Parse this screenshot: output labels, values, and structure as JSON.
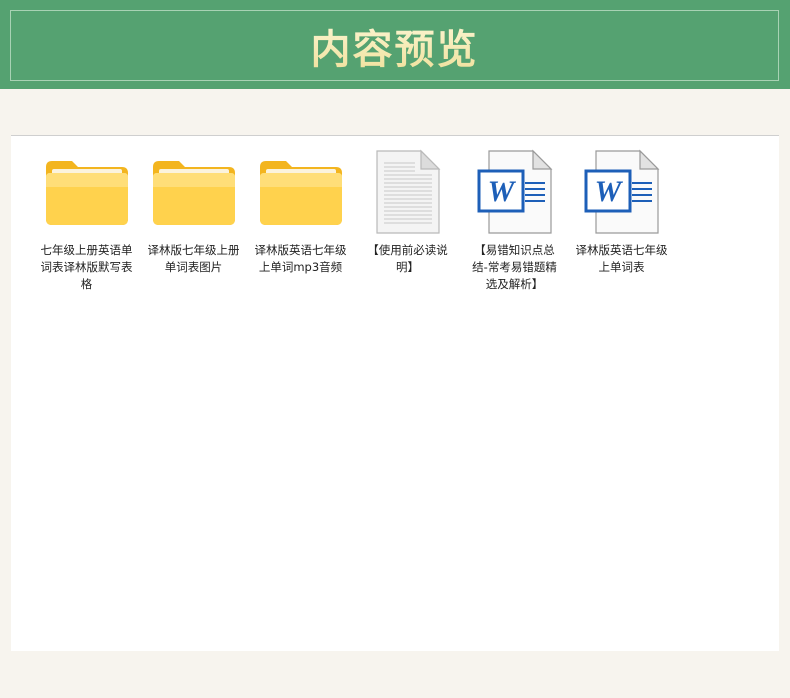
{
  "header": {
    "title": "内容预览"
  },
  "colors": {
    "banner": "#55a271",
    "title": "#f6eebb",
    "folder": "#ffd24d",
    "word_blue": "#1d5fb8"
  },
  "files": [
    {
      "type": "folder",
      "icon": "folder-icon",
      "label": "七年级上册英语单词表译林版默写表格"
    },
    {
      "type": "folder",
      "icon": "folder-icon",
      "label": "译林版七年级上册单词表图片"
    },
    {
      "type": "folder",
      "icon": "folder-icon",
      "label": "译林版英语七年级上单词mp3音频"
    },
    {
      "type": "text",
      "icon": "text-document-icon",
      "label": "【使用前必读说明】"
    },
    {
      "type": "word",
      "icon": "word-document-icon",
      "label": "【易错知识点总结-常考易错题精选及解析】"
    },
    {
      "type": "word",
      "icon": "word-document-icon",
      "label": "译林版英语七年级上单词表"
    }
  ]
}
